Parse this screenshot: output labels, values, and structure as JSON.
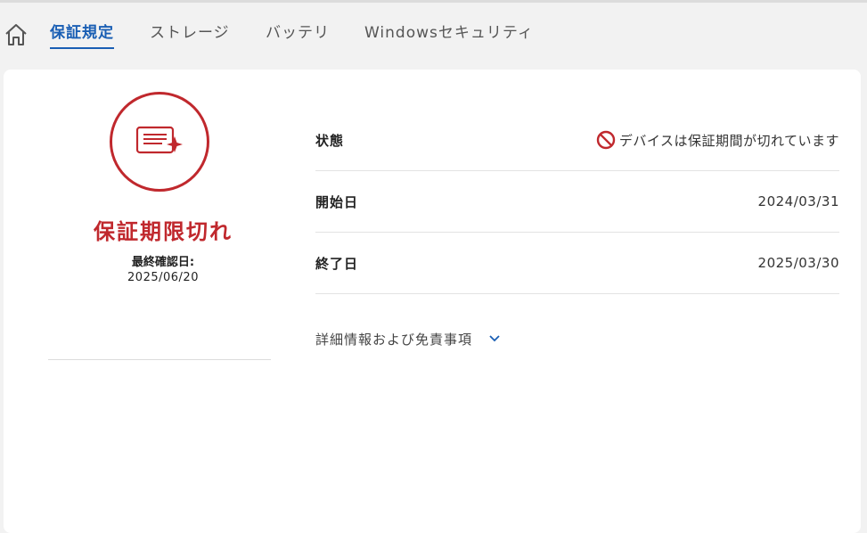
{
  "nav": {
    "home_icon": "home-icon",
    "tabs": [
      {
        "label": "保証規定",
        "active": true
      },
      {
        "label": "ストレージ",
        "active": false
      },
      {
        "label": "バッテリ",
        "active": false
      },
      {
        "label": "Windowsセキュリティ",
        "active": false
      }
    ]
  },
  "summary": {
    "icon": "warranty-certificate-icon",
    "status_title": "保証期限切れ",
    "last_checked_label": "最終確認日:",
    "last_checked_date": "2025/06/20"
  },
  "details": {
    "rows": [
      {
        "label": "状態",
        "value": "デバイスは保証期間が切れています",
        "icon": "prohibited-icon"
      },
      {
        "label": "開始日",
        "value": "2024/03/31"
      },
      {
        "label": "終了日",
        "value": "2025/03/30"
      }
    ],
    "more_label": "詳細情報および免責事項",
    "more_icon": "chevron-down-icon"
  },
  "colors": {
    "accent": "#1a5fb4",
    "danger": "#c0282d"
  }
}
